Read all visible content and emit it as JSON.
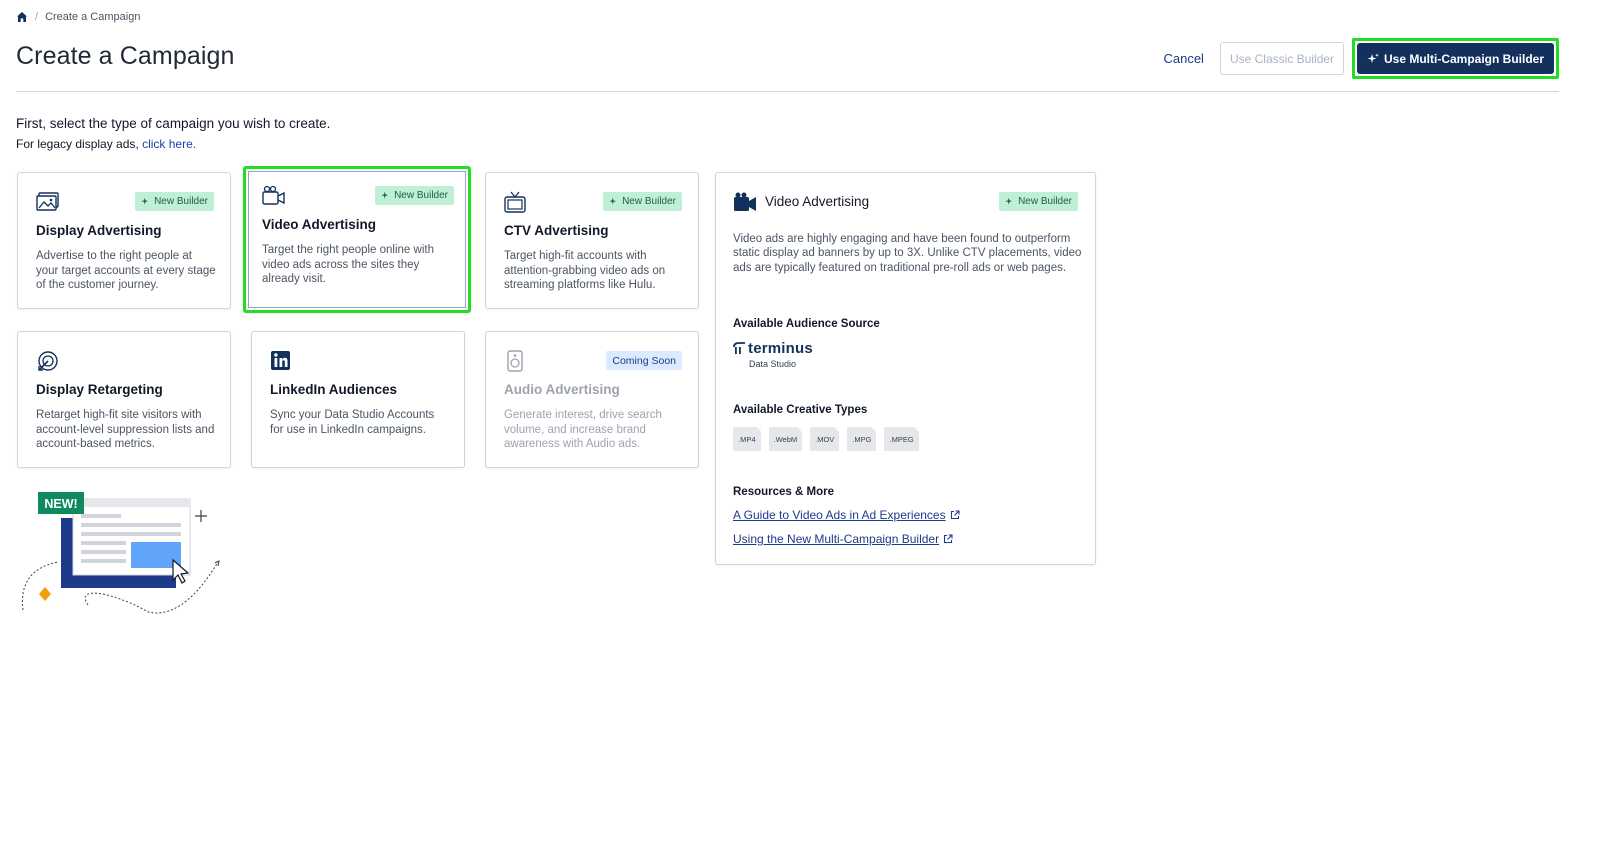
{
  "breadcrumb": {
    "current": "Create a Campaign",
    "separator": "/"
  },
  "page_title": "Create a Campaign",
  "actions": {
    "cancel": "Cancel",
    "classic_builder": "Use Classic Builder",
    "multi_builder": "Use Multi-Campaign Builder"
  },
  "intro": {
    "heading": "First, select the type of campaign you wish to create.",
    "legacy_prefix": "For legacy display ads,",
    "legacy_link": "click here."
  },
  "cards": [
    {
      "title": "Display Advertising",
      "badge": "New Builder",
      "icon": "display-image-icon",
      "description": "Advertise to the right people at your target accounts at every stage of the customer journey."
    },
    {
      "title": "Video Advertising",
      "badge": "New Builder",
      "icon": "video-camera-icon",
      "description": "Target the right people online with video ads across the sites they already visit.",
      "selected": true
    },
    {
      "title": "CTV Advertising",
      "badge": "New Builder",
      "icon": "tv-icon",
      "description": "Target high-fit accounts with attention-grabbing video ads on streaming platforms like Hulu."
    },
    {
      "title": "Display Retargeting",
      "badge": "",
      "icon": "retarget-icon",
      "description": "Retarget high-fit site visitors with account-level suppression lists and account-based metrics."
    },
    {
      "title": "LinkedIn Audiences",
      "badge": "",
      "icon": "linkedin-icon",
      "description": "Sync your Data Studio Accounts for use in LinkedIn campaigns."
    },
    {
      "title": "Audio Advertising",
      "badge": "Coming Soon",
      "icon": "speaker-icon",
      "description": "Generate interest, drive search volume, and increase brand awareness with Audio ads.",
      "disabled": true
    }
  ],
  "detail": {
    "title": "Video Advertising",
    "badge": "New Builder",
    "description": "Video ads are highly engaging and have been found to outperform static display ad banners by up to 3X. Unlike CTV placements, video ads are typically featured on traditional pre-roll ads or web pages.",
    "audience_heading": "Available Audience Source",
    "audience_brand": "terminus",
    "audience_sub": "Data Studio",
    "creative_heading": "Available Creative Types",
    "creative_types": [
      ".MP4",
      ".WebM",
      ".MOV",
      ".MPG",
      ".MPEG"
    ],
    "resources_heading": "Resources & More",
    "links": [
      "A Guide to Video Ads in Ad Experiences",
      "Using the New Multi-Campaign Builder"
    ]
  },
  "promo": {
    "badge": "NEW!"
  },
  "colors": {
    "primary": "#13315c",
    "badge_bg": "#bff0d6",
    "highlight": "#22dd22"
  }
}
